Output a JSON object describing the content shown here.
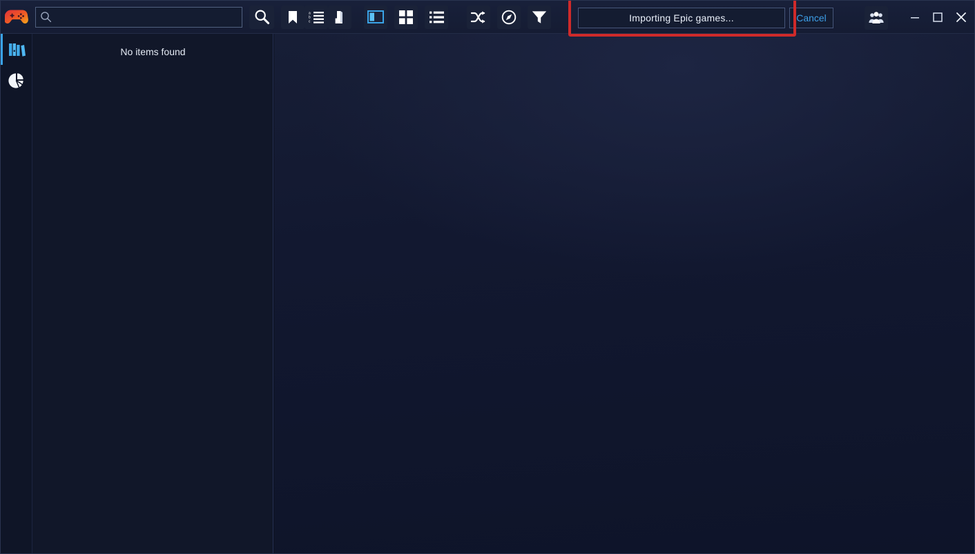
{
  "app": {
    "logo_icon": "gamepad-icon",
    "accent_color": "#3aa4e8",
    "highlight_color": "#cf2a2a",
    "logo_gradient_from": "#e0303a",
    "logo_gradient_to": "#f59b1c"
  },
  "search": {
    "value": "",
    "placeholder": "",
    "inline_icon": "search-icon",
    "button_icon": "search-icon"
  },
  "toolbar": {
    "buttons": [
      {
        "name": "bookmark-button",
        "icon": "bookmark-icon",
        "active": false
      },
      {
        "name": "sort-alphabetical-button",
        "icon": "sort-alphabetical-icon",
        "active": false
      },
      {
        "name": "sort-direction-button",
        "icon": "sort-direction-icon",
        "active": false
      },
      {
        "name": "split-view-button",
        "icon": "split-view-icon",
        "active": true
      },
      {
        "name": "grid-view-button",
        "icon": "grid-view-icon",
        "active": false
      },
      {
        "name": "list-view-button",
        "icon": "list-view-icon",
        "active": false
      },
      {
        "name": "shuffle-button",
        "icon": "shuffle-icon",
        "active": false
      },
      {
        "name": "compass-button",
        "icon": "compass-icon",
        "active": false
      },
      {
        "name": "filter-button",
        "icon": "filter-icon",
        "active": false
      }
    ]
  },
  "notification": {
    "message": "Importing Epic games...",
    "cancel_label": "Cancel",
    "highlighted": true
  },
  "window": {
    "community_icon": "community-icon",
    "minimize_icon": "minimize-icon",
    "maximize_icon": "maximize-icon",
    "close_icon": "close-icon"
  },
  "sidebar": {
    "items": [
      {
        "name": "sidebar-item-library",
        "icon": "library-icon",
        "active": true
      },
      {
        "name": "sidebar-item-statistics",
        "icon": "pie-chart-icon",
        "active": false
      }
    ]
  },
  "list_panel": {
    "empty_message": "No items found"
  }
}
